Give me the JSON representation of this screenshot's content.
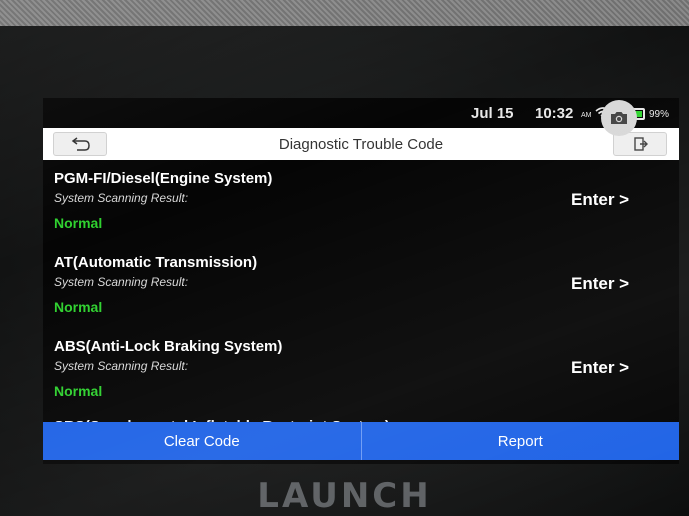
{
  "status_bar": {
    "date": "Jul 15",
    "time": "10:32",
    "ampm": "AM",
    "battery_pct": "99%",
    "battery_level": 0.99,
    "icons": [
      "wifi-icon",
      "battery-icon"
    ]
  },
  "title_bar": {
    "title": "Diagnostic Trouble Code",
    "back_icon": "back-arrow-icon",
    "exit_icon": "exit-icon"
  },
  "systems": [
    {
      "name": "PGM-FI/Diesel(Engine System)",
      "subtitle": "System Scanning Result:",
      "status": "Normal",
      "enter_label": "Enter >"
    },
    {
      "name": "AT(Automatic Transmission)",
      "subtitle": "System Scanning Result:",
      "status": "Normal",
      "enter_label": "Enter >"
    },
    {
      "name": "ABS(Anti-Lock Braking System)",
      "subtitle": "System Scanning Result:",
      "status": "Normal",
      "enter_label": "Enter >"
    }
  ],
  "partial_item": "SRS(Supplemental Inflatable Restraint System)",
  "camera_icon": "camera-icon",
  "buttons": {
    "clear_code": "Clear Code",
    "report": "Report"
  },
  "brand": "LAUNCH",
  "colors": {
    "status_normal": "#2fd12f",
    "button_blue": "#1f63e6"
  }
}
